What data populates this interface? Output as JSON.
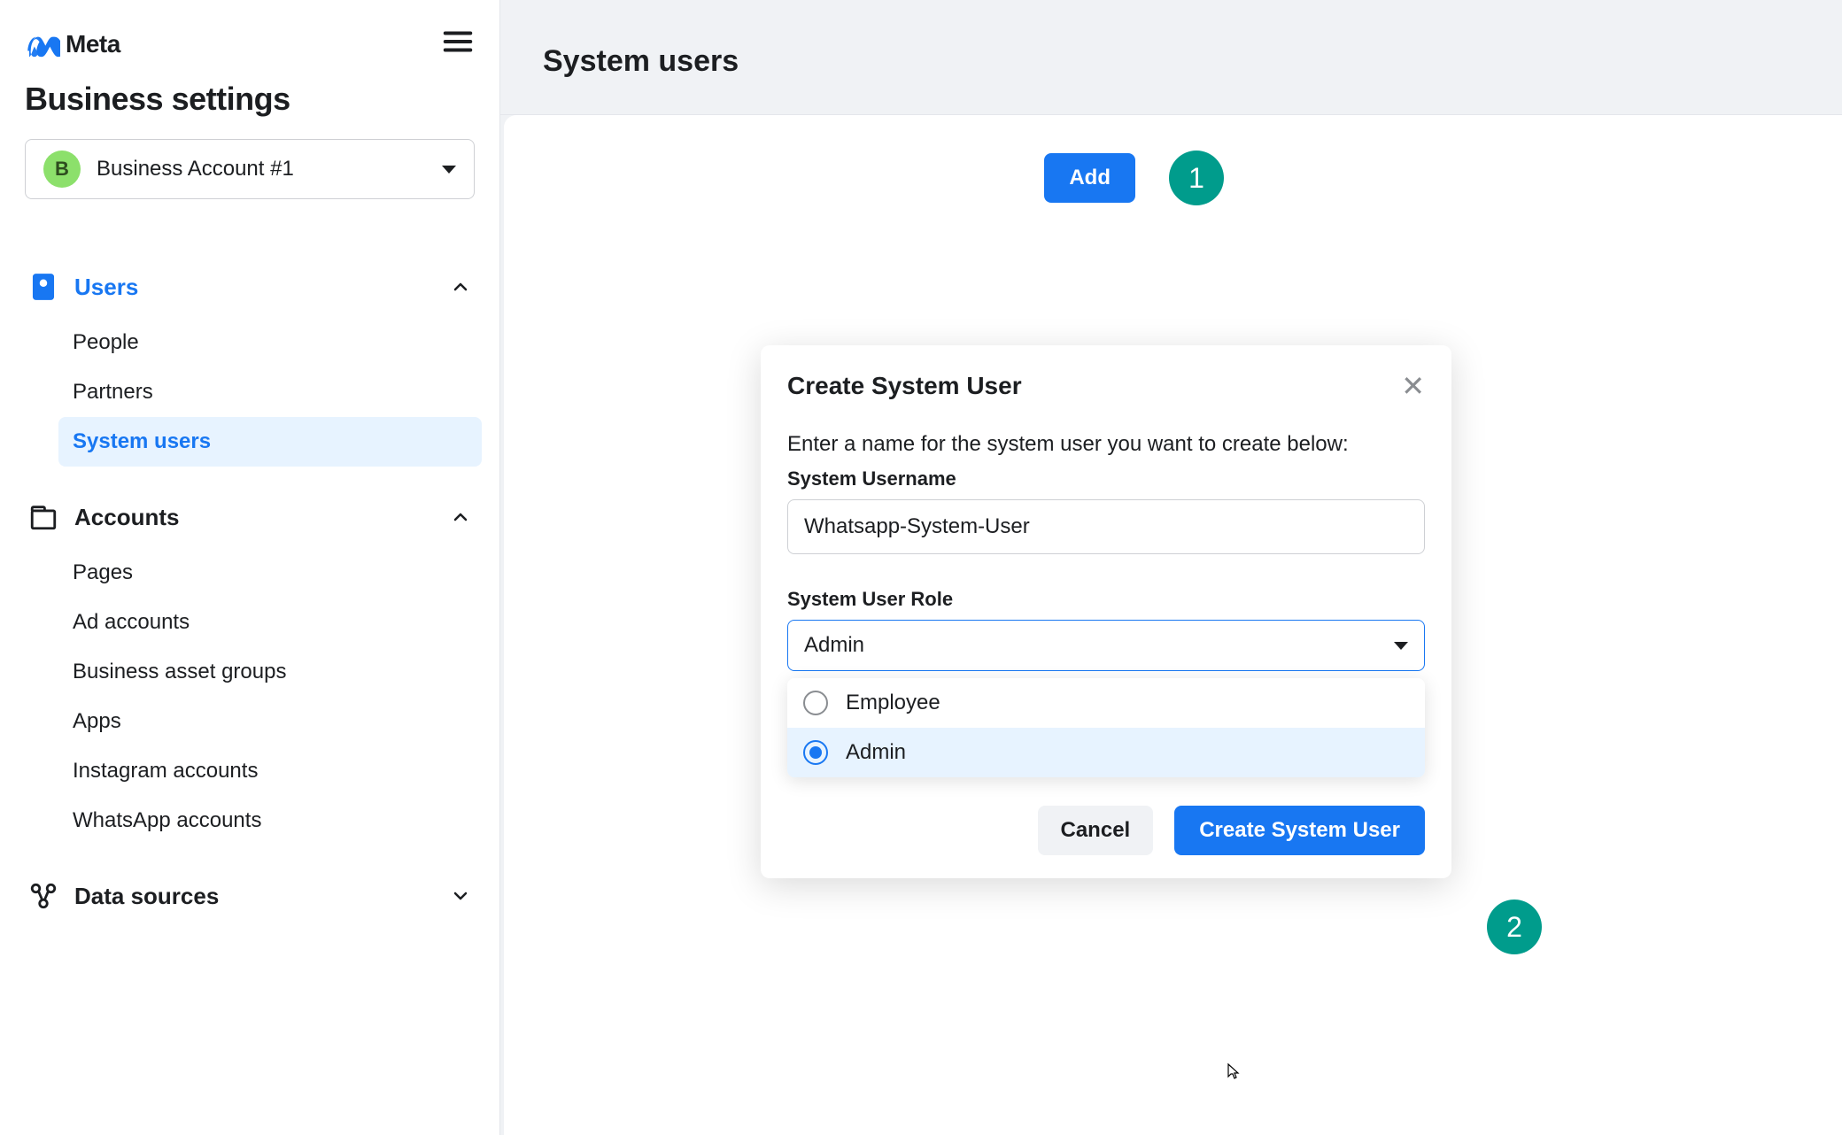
{
  "brand": "Meta",
  "page_title": "Business settings",
  "account": {
    "avatar_letter": "B",
    "name": "Business Account #1"
  },
  "sidebar": {
    "users": {
      "label": "Users",
      "items": [
        {
          "label": "People"
        },
        {
          "label": "Partners"
        },
        {
          "label": "System users"
        }
      ]
    },
    "accounts": {
      "label": "Accounts",
      "items": [
        {
          "label": "Pages"
        },
        {
          "label": "Ad accounts"
        },
        {
          "label": "Business asset groups"
        },
        {
          "label": "Apps"
        },
        {
          "label": "Instagram accounts"
        },
        {
          "label": "WhatsApp accounts"
        }
      ]
    },
    "data_sources": {
      "label": "Data sources"
    }
  },
  "main": {
    "heading": "System users",
    "add_button": "Add"
  },
  "steps": {
    "one": "1",
    "two": "2"
  },
  "modal": {
    "title": "Create System User",
    "description": "Enter a name for the system user you want to create below:",
    "username_label": "System Username",
    "username_value": "Whatsapp-System-User",
    "role_label": "System User Role",
    "role_selected": "Admin",
    "role_options": [
      {
        "label": "Employee"
      },
      {
        "label": "Admin"
      }
    ],
    "cancel": "Cancel",
    "submit": "Create System User"
  }
}
